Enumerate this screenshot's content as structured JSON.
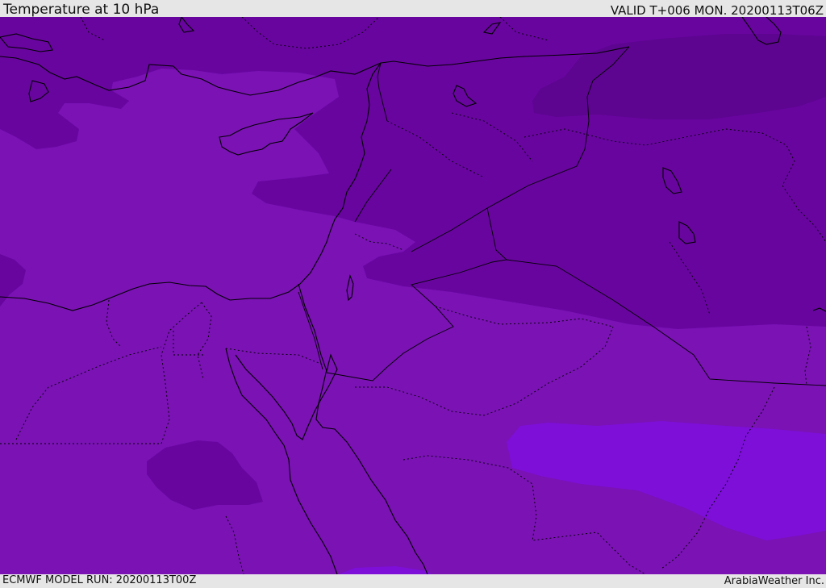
{
  "header": {
    "title": "Temperature at 10 hPa",
    "valid": "VALID T+006 MON. 20200113T06Z"
  },
  "footer": {
    "model_run": "ECMWF MODEL RUN: 20200113T00Z",
    "credit": "ArabiaWeather Inc."
  },
  "map": {
    "colors": {
      "base": "#7a12b4",
      "darker": "#68059f",
      "darkest": "#5d0590",
      "lighter": "#7d0fd9",
      "outline": "#000000"
    }
  }
}
